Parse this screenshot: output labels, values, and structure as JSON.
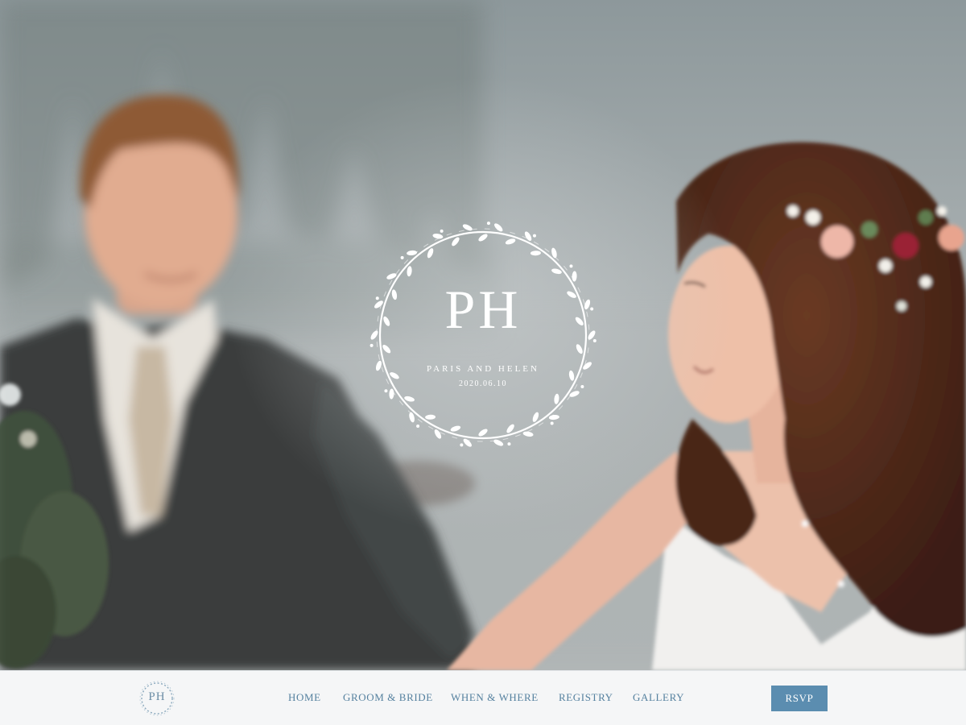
{
  "hero": {
    "monogram": "PH",
    "couple_names": "PARIS AND HELEN",
    "date": "2020.06.10"
  },
  "nav": {
    "logo": "PH",
    "links": [
      "HOME",
      "GROOM & BRIDE",
      "WHEN & WHERE",
      "REGISTRY",
      "GALLERY"
    ],
    "rsvp_label": "RSVP"
  },
  "colors": {
    "accent": "#5b8db0",
    "nav_text": "#55819f",
    "nav_background": "#f5f6f7",
    "emblem": "#ffffff"
  },
  "icons": [
    "floral-wreath-icon",
    "logo-wreath-icon"
  ]
}
